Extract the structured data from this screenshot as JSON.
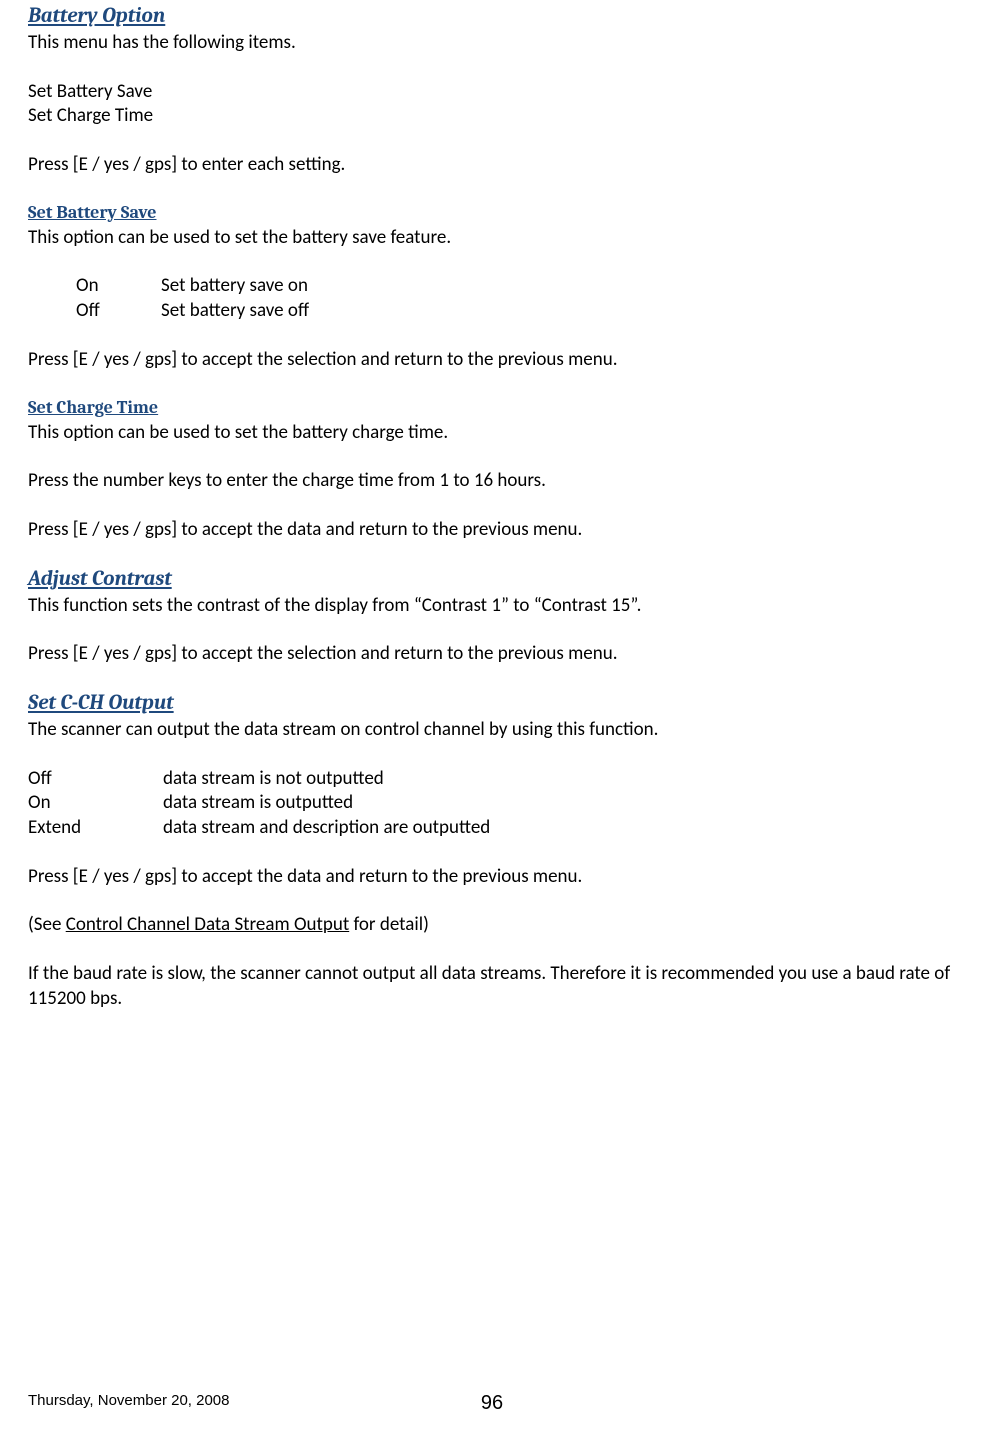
{
  "sections": {
    "battery_option": {
      "title": "Battery Option",
      "intro": "This menu has the following items.",
      "items": [
        "Set Battery Save",
        "Set Charge Time"
      ],
      "instruction": "Press [E / yes / gps] to enter each setting."
    },
    "set_battery_save": {
      "title": "Set Battery Save",
      "intro": "This option can be used to set the battery save feature.",
      "options": [
        {
          "label": "On",
          "desc": "Set battery save on"
        },
        {
          "label": "Off",
          "desc": " Set battery save off"
        }
      ],
      "instruction": "Press [E / yes / gps] to accept the selection and return to the previous menu."
    },
    "set_charge_time": {
      "title": "Set Charge Time",
      "intro": "This option can be used to set the battery charge time.",
      "instruction1": "Press the number keys to enter the charge time from 1 to 16 hours.",
      "instruction2": "Press [E / yes / gps] to accept the data and return to the previous menu."
    },
    "adjust_contrast": {
      "title": "Adjust Contrast",
      "intro": "This function sets the contrast of the display from “Contrast 1” to “Contrast 15”.",
      "instruction": "Press [E / yes / gps] to accept the selection and return to the previous menu."
    },
    "set_cch_output": {
      "title": "Set C-CH Output",
      "intro": "The scanner can output the data stream on control channel by using this function.",
      "options": [
        {
          "label": "Off",
          "desc": "data stream is not outputted"
        },
        {
          "label": "On",
          "desc": "data stream is outputted"
        },
        {
          "label": "Extend",
          "desc": "data stream and description are outputted"
        }
      ],
      "instruction": "Press [E / yes / gps] to accept the data and return to the previous menu.",
      "see_prefix": "(See ",
      "see_link": "Control Channel Data Stream Output",
      "see_suffix": " for detail)",
      "baud_note": "If the baud rate is slow, the scanner cannot output all data streams. Therefore it is recommended you use a baud rate of  115200 bps."
    }
  },
  "footer": {
    "date": "Thursday, November 20, 2008",
    "page": "96"
  }
}
